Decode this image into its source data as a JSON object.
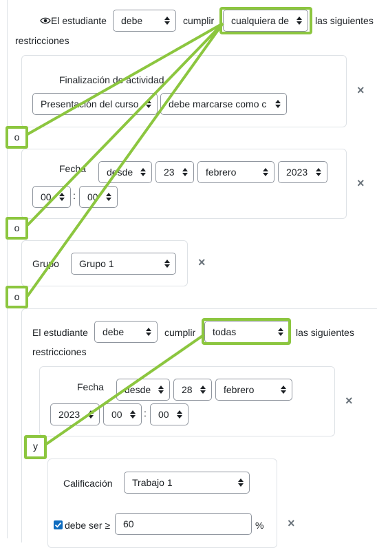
{
  "root": {
    "eye_icon": "eye-icon",
    "student_label": "El estudiante",
    "must_value": "debe",
    "fulfil_label": "cumplir",
    "match_value": "cualquiera de",
    "following_label": "las siguientes",
    "restrictions_label": "restricciones"
  },
  "completion": {
    "title": "Finalización de actividad",
    "activity_value": "Presentación del curso",
    "condition_value": "debe marcarse como c"
  },
  "date1": {
    "label": "Fecha",
    "direction_value": "desde",
    "day_value": "23",
    "month_value": "febrero",
    "year_value": "2023",
    "hour_value": "00",
    "colon": ":",
    "minute_value": "00"
  },
  "group": {
    "label": "Grupo",
    "value": "Grupo 1"
  },
  "nested": {
    "student_label": "El estudiante",
    "must_value": "debe",
    "fulfil_label": "cumplir",
    "match_value": "todas",
    "following_label": "las siguientes",
    "restrictions_label": "restricciones"
  },
  "date2": {
    "label": "Fecha",
    "direction_value": "desde",
    "day_value": "28",
    "month_value": "febrero",
    "year_value": "2023",
    "hour_value": "00",
    "colon": ":",
    "minute_value": "00"
  },
  "grade": {
    "label": "Calificación",
    "item_value": "Trabajo 1",
    "must_be_label": "debe ser ≥",
    "value": "60",
    "percent": "%"
  },
  "operators": {
    "or_1": "o",
    "or_2": "o",
    "or_3": "o",
    "and_1": "y"
  },
  "delete_icon": "×",
  "colors": {
    "highlight": "#8cc63f",
    "border": "#dee2e6",
    "checkbox": "#0f6cbf"
  }
}
